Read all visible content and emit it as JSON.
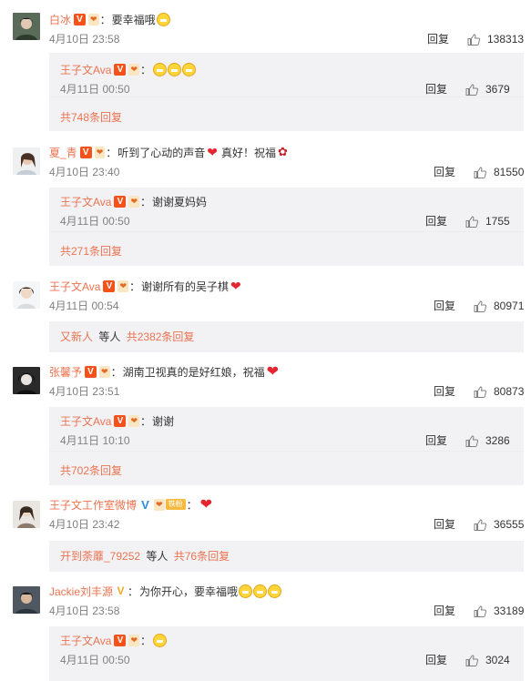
{
  "ui": {
    "reply": "回复",
    "etal": "等人"
  },
  "comments": [
    {
      "user": "白冰",
      "text": "要幸福哦",
      "time": "4月10日 23:58",
      "likes": "138313",
      "reply": {
        "user": "王子文Ava",
        "time": "4月11日 00:50",
        "likes": "3679"
      },
      "more": "共748条回复"
    },
    {
      "user": "夏_青",
      "text": "听到了心动的声音",
      "text2": "真好！祝福",
      "time": "4月10日 23:40",
      "likes": "81550",
      "reply": {
        "user": "王子文Ava",
        "text": "谢谢夏妈妈",
        "time": "4月11日 00:50",
        "likes": "1755"
      },
      "more": "共271条回复"
    },
    {
      "user": "王子文Ava",
      "text": "谢谢所有的吴子棋",
      "time": "4月11日 00:54",
      "likes": "80971",
      "more_user": "又新人",
      "more": "共2382条回复"
    },
    {
      "user": "张馨予",
      "text": "湖南卫视真的是好红娘，祝福",
      "time": "4月10日 23:51",
      "likes": "80873",
      "reply": {
        "user": "王子文Ava",
        "text": "谢谢",
        "time": "4月11日 10:10",
        "likes": "3286"
      },
      "more": "共702条回复"
    },
    {
      "user": "王子文工作室微博",
      "fan_label": "铁粉",
      "time": "4月10日 23:42",
      "likes": "36555",
      "more_user": "开到荼蘼_79252",
      "more": "共76条回复"
    },
    {
      "user": "Jackie刘丰源",
      "text": "为你开心，要幸福哦",
      "time": "4月10日 23:58",
      "likes": "33189",
      "reply": {
        "user": "王子文Ava",
        "time": "4月11日 00:50",
        "likes": "3024"
      }
    }
  ]
}
